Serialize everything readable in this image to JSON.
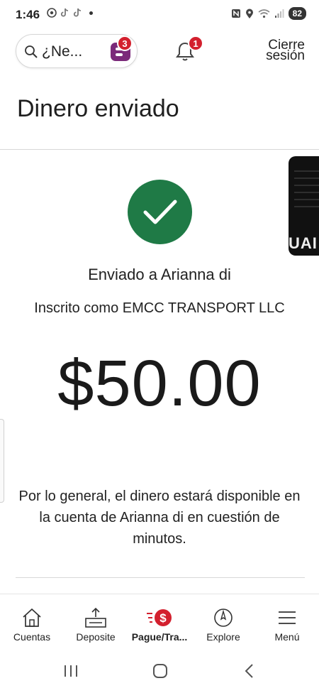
{
  "status_bar": {
    "time": "1:46",
    "battery": "82"
  },
  "top_bar": {
    "search_text": "¿Ne...",
    "erica_badge": "3",
    "bell_badge": "1",
    "signout_line1": "Cierre",
    "signout_line2": "sesión"
  },
  "page_title": "Dinero enviado",
  "peek_card_text": "UAI",
  "confirmation": {
    "sent_to": "Enviado a Arianna di",
    "enrolled_as": "Inscrito como EMCC TRANSPORT LLC",
    "amount": "$50.00",
    "note": "Por lo general, el dinero estará disponible en la cuenta de Arianna di en cuestión de minutos."
  },
  "bottom_nav": {
    "items": [
      {
        "label": "Cuentas",
        "icon": "house-icon"
      },
      {
        "label": "Deposite",
        "icon": "deposit-icon"
      },
      {
        "label": "Pague/Tra...",
        "icon": "pay-transfer-icon",
        "active": true
      },
      {
        "label": "Explore",
        "icon": "compass-icon"
      },
      {
        "label": "Menú",
        "icon": "menu-icon"
      }
    ]
  },
  "colors": {
    "success_green": "#1f7a46",
    "badge_red": "#d3202e",
    "erica_purple": "#7b2a7a"
  }
}
